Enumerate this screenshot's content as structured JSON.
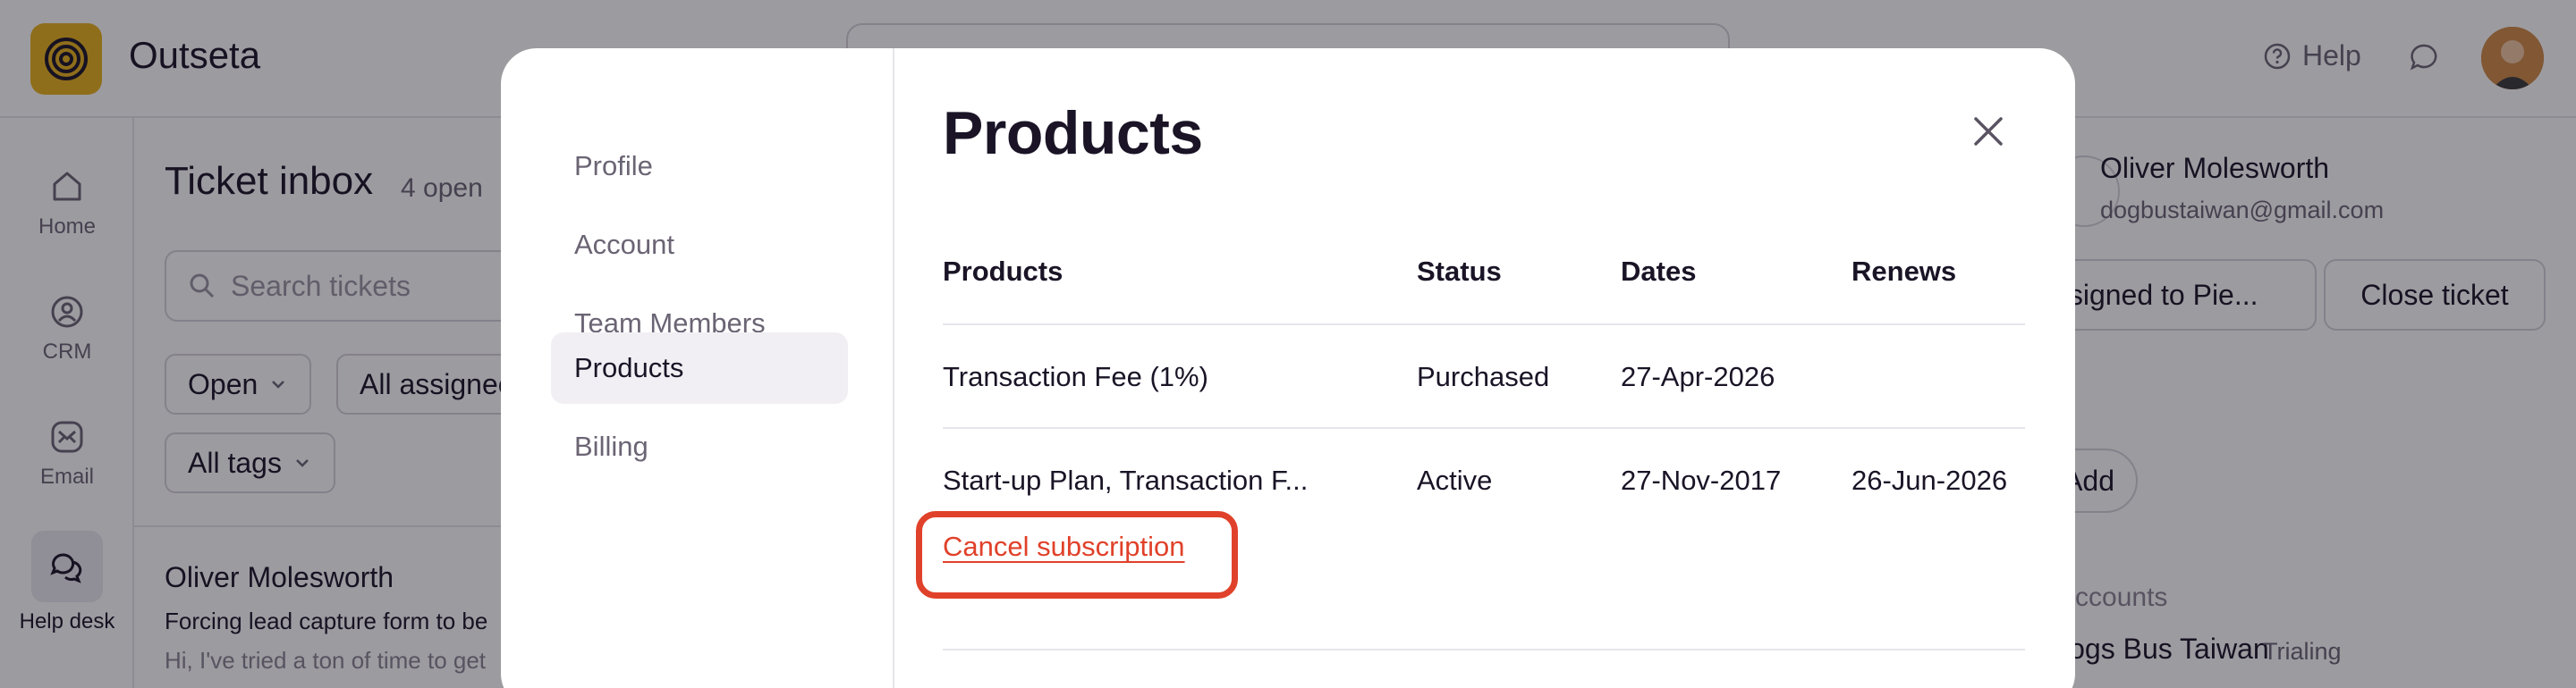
{
  "app": {
    "brand": "Outseta",
    "help_label": "Help",
    "nav": [
      {
        "label": "Home"
      },
      {
        "label": "CRM"
      },
      {
        "label": "Email"
      },
      {
        "label": "Help desk"
      }
    ],
    "inbox": {
      "title": "Ticket inbox",
      "count": "4 open",
      "search_placeholder": "Search tickets",
      "filter_status": "Open",
      "filter_assignee": "All assignees",
      "filter_tags": "All tags",
      "ticket": {
        "name": "Oliver Molesworth",
        "subject": "Forcing lead capture form to be",
        "preview": "Hi, I've tried a ton of time to get"
      }
    },
    "contact": {
      "name": "Oliver Molesworth",
      "email": "dogbustaiwan@gmail.com",
      "assigned_label": "Assigned to Pie...",
      "close_ticket_label": "Close ticket",
      "add_label": "Add",
      "accounts_label": "Accounts",
      "account_name": "Dogs Bus Taiwan",
      "account_status": "Trialing"
    }
  },
  "modal": {
    "title": "Products",
    "sidebar": [
      {
        "label": "Profile"
      },
      {
        "label": "Account"
      },
      {
        "label": "Team Members"
      },
      {
        "label": "Products",
        "active": true
      },
      {
        "label": "Billing"
      }
    ],
    "table": {
      "headers": [
        "Products",
        "Status",
        "Dates",
        "Renews"
      ],
      "rows": [
        {
          "product": "Transaction Fee (1%)",
          "status": "Purchased",
          "dates": "27-Apr-2026",
          "renews": ""
        },
        {
          "product": "Start-up Plan, Transaction F...",
          "status": "Active",
          "dates": "27-Nov-2017",
          "renews": "26-Jun-2026"
        }
      ]
    },
    "cancel_label": "Cancel subscription"
  },
  "colors": {
    "accent_red": "#e0412a",
    "brand_yellow": "#e8b21a",
    "text_dark": "#1a1426",
    "text_muted": "#6b6474"
  },
  "icons": [
    "outseta-logo-icon",
    "help-icon",
    "chat-icon",
    "home-icon",
    "crm-icon",
    "email-icon",
    "helpdesk-icon",
    "search-icon",
    "chevron-down-icon",
    "close-icon"
  ]
}
